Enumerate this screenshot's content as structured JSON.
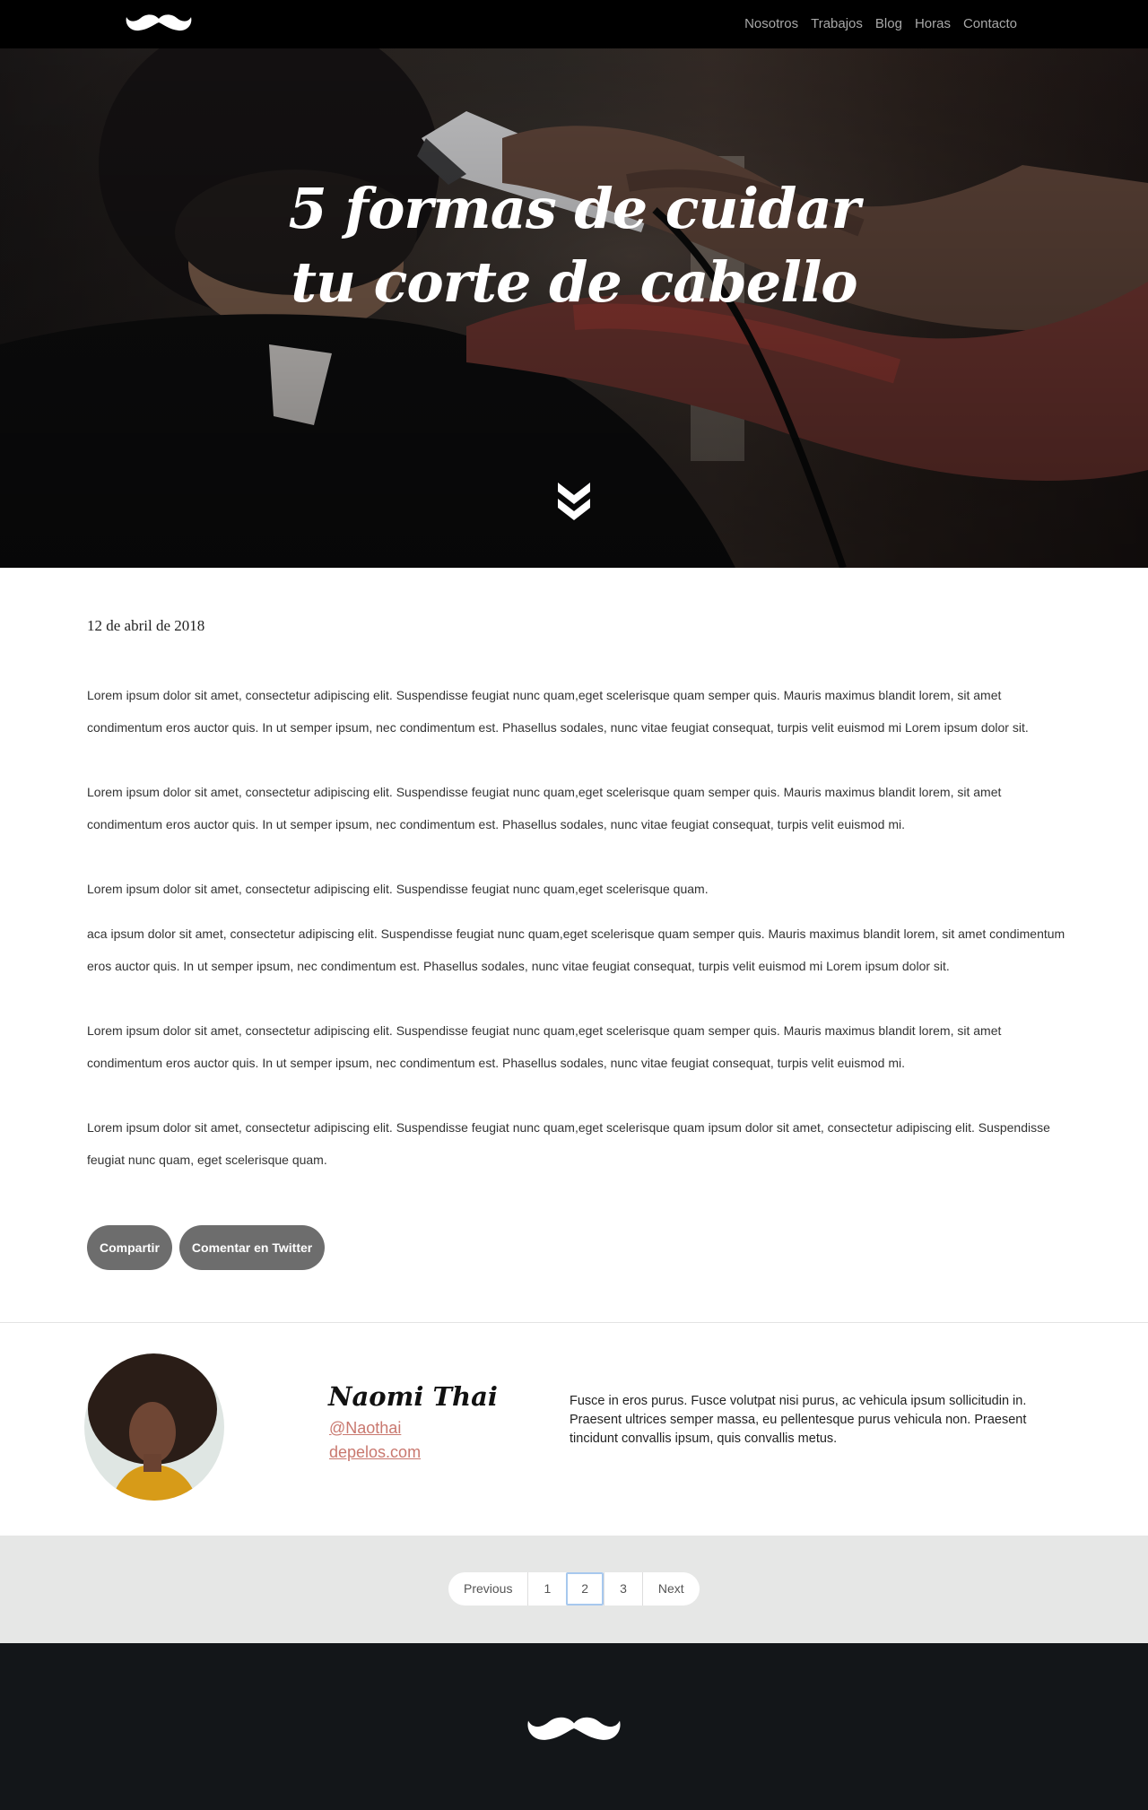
{
  "nav": {
    "links": [
      "Nosotros",
      "Trabajos",
      "Blog",
      "Horas",
      "Contacto"
    ]
  },
  "hero": {
    "title_line1": "5 formas de cuidar",
    "title_line2": "tu corte de cabello"
  },
  "article": {
    "date": "12 de abril de 2018",
    "paragraphs": [
      "Lorem ipsum dolor sit amet, consectetur adipiscing elit. Suspendisse feugiat nunc quam,eget scelerisque quam semper quis. Mauris maximus blandit lorem, sit amet condimentum eros auctor quis. In ut semper ipsum, nec condimentum est. Phasellus sodales, nunc vitae feugiat consequat, turpis velit euismod mi Lorem ipsum dolor sit.",
      "Lorem ipsum dolor sit amet, consectetur adipiscing elit. Suspendisse feugiat nunc quam,eget scelerisque quam semper quis. Mauris maximus blandit lorem, sit amet condimentum eros auctor quis. In ut semper ipsum, nec condimentum est. Phasellus sodales, nunc vitae feugiat consequat, turpis velit euismod mi.",
      "Lorem ipsum dolor sit amet, consectetur adipiscing elit. Suspendisse feugiat nunc quam,eget scelerisque quam.",
      "aca ipsum dolor sit amet, consectetur adipiscing elit. Suspendisse feugiat nunc quam,eget scelerisque quam semper quis. Mauris maximus blandit lorem, sit amet condimentum eros auctor quis. In ut semper ipsum, nec condimentum est. Phasellus sodales, nunc vitae feugiat consequat, turpis velit euismod mi Lorem ipsum dolor sit.",
      "Lorem ipsum dolor sit amet, consectetur adipiscing elit. Suspendisse feugiat nunc quam,eget scelerisque quam semper quis. Mauris maximus blandit lorem, sit amet condimentum eros auctor quis. In ut semper ipsum, nec condimentum est. Phasellus sodales, nunc vitae feugiat consequat, turpis velit euismod mi.",
      "Lorem ipsum dolor sit amet, consectetur adipiscing elit. Suspendisse feugiat nunc quam,eget scelerisque quam ipsum dolor sit amet, consectetur adipiscing elit. Suspendisse feugiat nunc quam, eget scelerisque quam."
    ],
    "share_label": "Compartir",
    "twitter_label": "Comentar en Twitter"
  },
  "author": {
    "name": "Naomi Thai",
    "handle": "@Naothai",
    "site": "depelos.com",
    "bio": "Fusce in eros purus. Fusce volutpat nisi purus, ac vehicula ipsum sollicitudin in. Praesent ultrices semper massa, eu pellentesque purus vehicula non. Praesent tincidunt convallis ipsum, quis convallis metus."
  },
  "pagination": {
    "previous": "Previous",
    "pages": [
      "1",
      "2",
      "3"
    ],
    "active_page": "2",
    "next": "Next"
  },
  "colors": {
    "nav_bg": "#000000",
    "link_accent": "#c9786f",
    "pill_bg": "#6d6d6d",
    "pager_bg": "#e6e7e6",
    "footer_bg": "#131619"
  },
  "icons": {
    "logo": "mustache-icon",
    "scroll": "double-chevron-down-icon"
  }
}
